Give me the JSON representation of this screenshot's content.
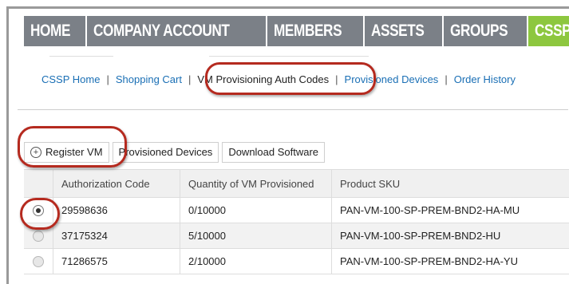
{
  "topnav": {
    "items": [
      "HOME",
      "COMPANY ACCOUNT",
      "MEMBERS",
      "ASSETS",
      "GROUPS",
      "CSSP"
    ],
    "active_index": 5
  },
  "subnav": {
    "links": [
      "CSSP Home",
      "Shopping Cart",
      "VM Provisioning Auth Codes",
      "Provisioned Devices",
      "Order History"
    ],
    "active_index": 2
  },
  "toolbar": {
    "register_label": "Register VM",
    "provisioned_label": "Provisioned Devices",
    "download_label": "Download Software"
  },
  "table": {
    "columns": [
      "",
      "Authorization Code",
      "Quantity of VM Provisioned",
      "Product SKU"
    ],
    "rows": [
      {
        "selected": true,
        "code": "29598636",
        "quantity": "0/10000",
        "sku": "PAN-VM-100-SP-PREM-BND2-HA-MU"
      },
      {
        "selected": false,
        "code": "37175324",
        "quantity": "5/10000",
        "sku": "PAN-VM-100-SP-PREM-BND2-HU"
      },
      {
        "selected": false,
        "code": "71286575",
        "quantity": "2/10000",
        "sku": "PAN-VM-100-SP-PREM-BND2-HA-YU"
      }
    ]
  },
  "colors": {
    "nav_bg": "#7b8087",
    "nav_active": "#8dc73f",
    "link": "#1a6fb5",
    "annotation": "#b52a1f"
  }
}
